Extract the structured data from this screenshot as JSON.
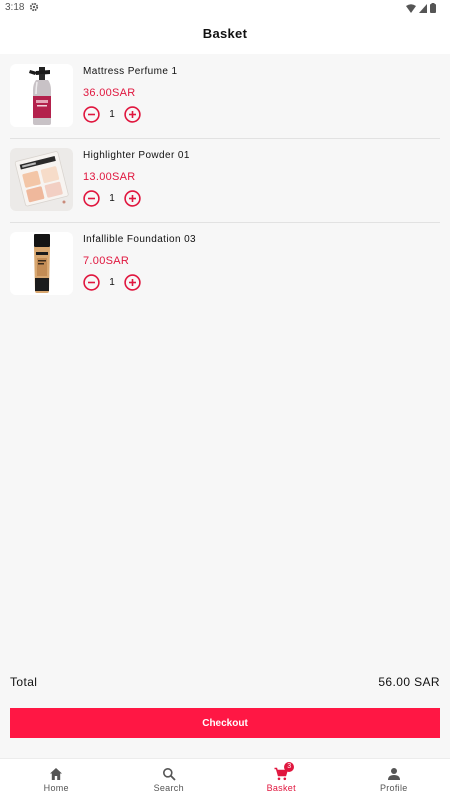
{
  "status_bar": {
    "time": "3:18"
  },
  "header": {
    "title": "Basket"
  },
  "basket": {
    "items": [
      {
        "name": "Mattress Perfume 1",
        "price": "36.00SAR",
        "quantity": "1",
        "image": "spray-bottle"
      },
      {
        "name": "Highlighter Powder 01",
        "price": "13.00SAR",
        "quantity": "1",
        "image": "highlighter-palette"
      },
      {
        "name": "Infallible Foundation 03",
        "price": "7.00SAR",
        "quantity": "1",
        "image": "foundation-tube"
      }
    ]
  },
  "summary": {
    "total_label": "Total",
    "total_value": "56.00 SAR"
  },
  "checkout": {
    "label": "Checkout"
  },
  "nav": {
    "items": [
      {
        "label": "Home",
        "icon": "home-icon"
      },
      {
        "label": "Search",
        "icon": "search-icon"
      },
      {
        "label": "Basket",
        "icon": "cart-icon",
        "badge": "3",
        "active": true
      },
      {
        "label": "Profile",
        "icon": "person-icon"
      }
    ]
  },
  "colors": {
    "accent": "#ff1744",
    "price": "#e0163e",
    "background": "#f7f7f7"
  }
}
